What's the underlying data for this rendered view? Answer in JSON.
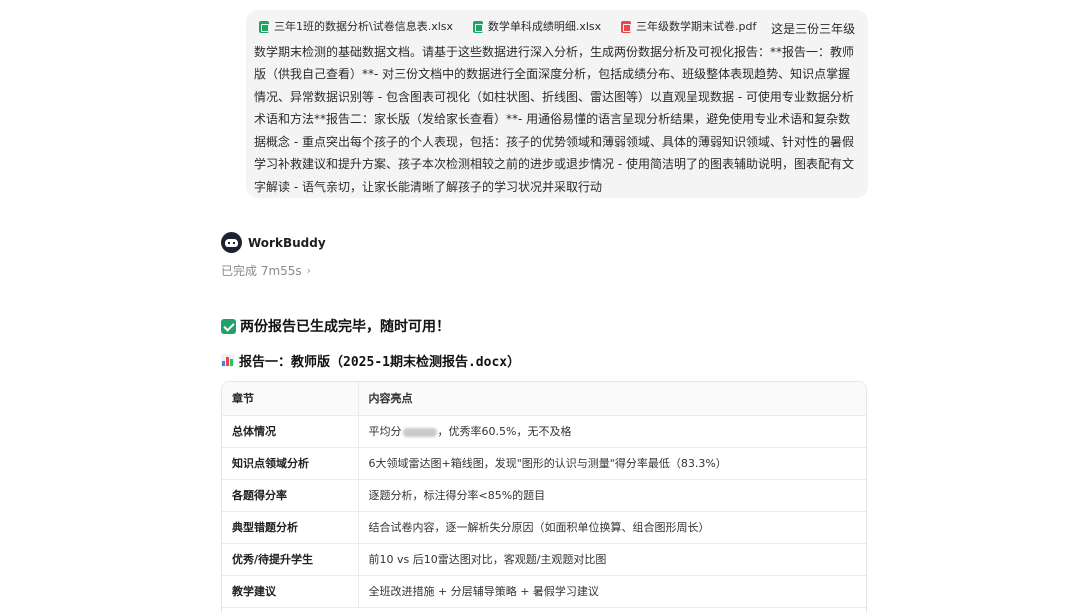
{
  "user_message": {
    "attachments": [
      {
        "name": "三年1班的数据分析\\试卷信息表.xlsx",
        "type": "xlsx",
        "icon": "excel-file-icon"
      },
      {
        "name": "数学单科成绩明细.xlsx",
        "type": "xlsx",
        "icon": "excel-file-icon"
      },
      {
        "name": "三年级数学期末试卷.pdf",
        "type": "pdf",
        "icon": "pdf-file-icon"
      }
    ],
    "text": "这是三份三年级数学期末检测的基础数据文档。请基于这些数据进行深入分析，生成两份数据分析及可视化报告：**报告一：教师版（供我自己查看）**- 对三份文档中的数据进行全面深度分析，包括成绩分布、班级整体表现趋势、知识点掌握情况、异常数据识别等 - 包含图表可视化（如柱状图、折线图、雷达图等）以直观呈现数据 - 可使用专业数据分析术语和方法**报告二：家长版（发给家长查看）**- 用通俗易懂的语言呈现分析结果，避免使用专业术语和复杂数据概念 - 重点突出每个孩子的个人表现，包括：孩子的优势领域和薄弱领域、具体的薄弱知识领域、针对性的暑假学习补救建议和提升方案、孩子本次检测相较之前的进步或退步情况 - 使用简洁明了的图表辅助说明，图表配有文字解读 - 语气亲切，让家长能清晰了解孩子的学习状况并采取行动"
  },
  "agent": {
    "name": "WorkBuddy",
    "status": "已完成 7m55s",
    "status_chevron": "›"
  },
  "response": {
    "headline": "两份报告已生成完毕，随时可用！",
    "report1_prefix": "报告一：教师版（",
    "report1_file": "2025-1期末检测报告.docx",
    "report1_suffix": "）",
    "table": {
      "headers": [
        "章节",
        "内容亮点"
      ],
      "rows": [
        {
          "section": "总体情况",
          "highlight_before": "平均分",
          "highlight_after": "，优秀率60.5%，无不及格"
        },
        {
          "section": "知识点领域分析",
          "highlight": "6大领域雷达图+箱线图，发现\"图形的认识与测量\"得分率最低（83.3%）"
        },
        {
          "section": "各题得分率",
          "highlight": "逐题分析，标注得分率<85%的题目"
        },
        {
          "section": "典型错题分析",
          "highlight": "结合试卷内容，逐一解析失分原因（如面积单位换算、组合图形周长）"
        },
        {
          "section": "优秀/待提升学生",
          "highlight": "前10 vs 后10雷达图对比，客观题/主观题对比图"
        },
        {
          "section": "教学建议",
          "highlight": "全班改进措施 + 分层辅导策略 + 暑假学习建议"
        }
      ]
    }
  }
}
